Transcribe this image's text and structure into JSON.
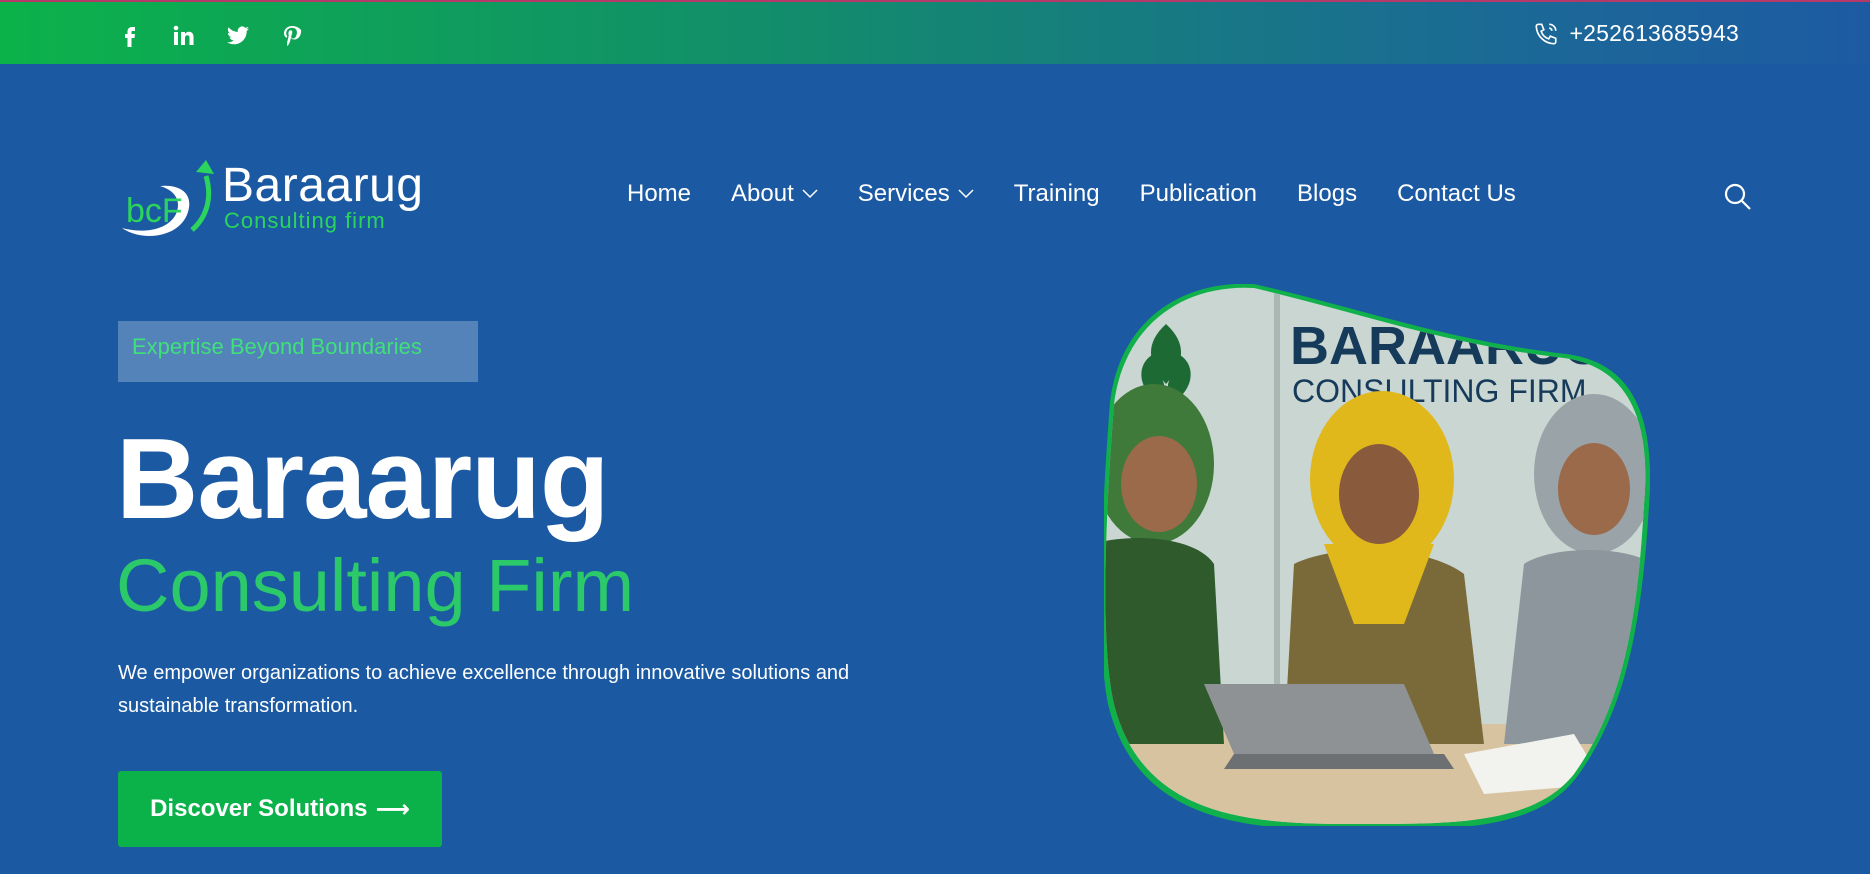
{
  "topbar": {
    "social": [
      {
        "icon": "facebook-icon"
      },
      {
        "icon": "linkedin-icon"
      },
      {
        "icon": "twitter-icon"
      },
      {
        "icon": "pinterest-icon"
      }
    ],
    "phone_icon": "phone-icon",
    "phone": "+252613685943"
  },
  "logo": {
    "name": "Baraarug",
    "tagline": "Consulting firm",
    "mark_text": "bcF"
  },
  "nav": {
    "items": [
      {
        "label": "Home",
        "has_dropdown": false
      },
      {
        "label": "About",
        "has_dropdown": true
      },
      {
        "label": "Services",
        "has_dropdown": true
      },
      {
        "label": "Training",
        "has_dropdown": false
      },
      {
        "label": "Publication",
        "has_dropdown": false
      },
      {
        "label": "Blogs",
        "has_dropdown": false
      },
      {
        "label": "Contact Us",
        "has_dropdown": false
      }
    ],
    "search_icon": "search-icon"
  },
  "hero": {
    "badge": "Expertise Beyond Boundaries",
    "title": "Baraarug",
    "subtitle": "Consulting Firm",
    "description": "We empower organizations to achieve excellence through innovative solutions and sustainable transformation.",
    "cta_label": "Discover Solutions",
    "cta_arrow": "⟶",
    "image_sign_line1": "BARAARUG",
    "image_sign_line2": "CONSULTING FIRM"
  },
  "colors": {
    "background": "#1b5aa3",
    "accent_green": "#0bb24a",
    "light_green": "#2cc96a",
    "white": "#ffffff"
  }
}
